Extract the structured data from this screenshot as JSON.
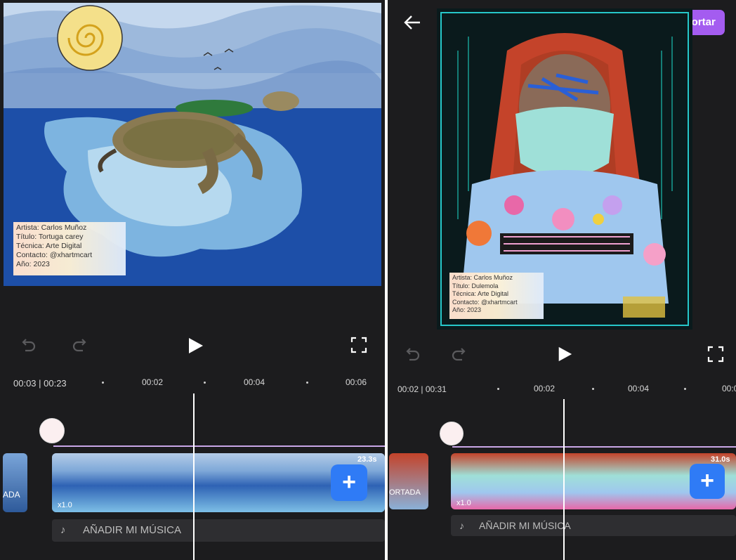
{
  "left": {
    "caption_lines": [
      "Artista: Carlos Muñoz",
      "Título: Tortuga carey",
      "Técnica: Arte Digital",
      "Contacto: @xhartmcart",
      "Año: 2023"
    ],
    "time": "00:03 | 00:23",
    "ticks": [
      "00:02",
      "00:04",
      "00:06"
    ],
    "clip_duration": "23.3s",
    "speed": "x1.0",
    "cover_label": "ADA",
    "music_label": "AÑADIR MI MÚSICA"
  },
  "right": {
    "export_label": "Exportar",
    "caption_lines": [
      "Artista: Carlos Muñoz",
      "Título: Dulemola",
      "Técnica: Arte Digital",
      "Contacto: @xhartmcart",
      "Año: 2023"
    ],
    "time": "00:02 | 00:31",
    "ticks": [
      "00:02",
      "00:04",
      "00:0"
    ],
    "clip_duration": "31.0s",
    "speed": "x1.0",
    "cover_label": "ORTADA",
    "music_label": "AÑADIR MI MÚSICA"
  },
  "colors": {
    "accent": "#2f7bf6",
    "export": "#a45cf0",
    "track": "#c9a7e8",
    "bg": "#1c1c1e"
  },
  "icons": [
    "undo-icon",
    "redo-icon",
    "play-icon",
    "fullscreen-icon",
    "back-arrow-icon",
    "help-icon",
    "music-note-icon",
    "plus-icon"
  ]
}
